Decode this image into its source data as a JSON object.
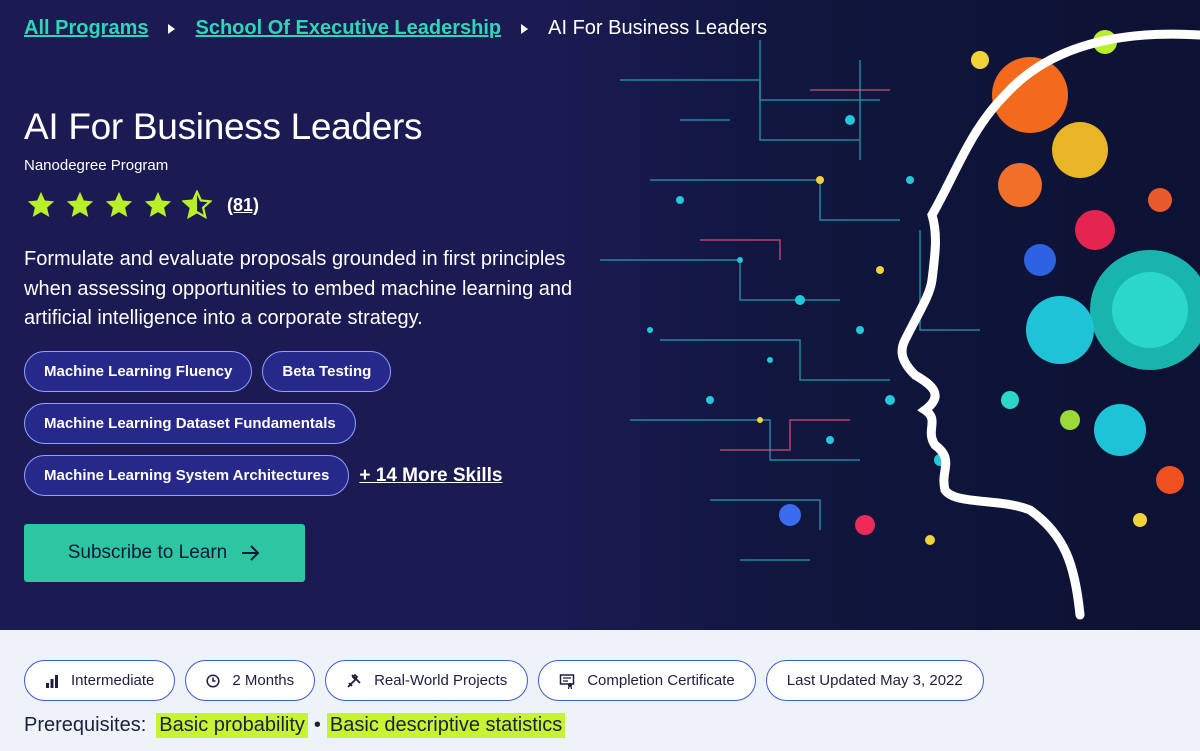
{
  "breadcrumb": {
    "items": [
      "All Programs",
      "School Of Executive Leadership"
    ],
    "current": "AI For Business Leaders"
  },
  "program": {
    "title": "AI For Business Leaders",
    "type": "Nanodegree Program",
    "rating": 4.5,
    "rating_count": "(81)",
    "description": "Formulate and evaluate proposals grounded in first principles when assessing opportunities to embed machine learning and artificial intelligence into a corporate strategy."
  },
  "skills": {
    "items": [
      "Machine Learning Fluency",
      "Beta Testing",
      "Machine Learning Dataset Fundamentals",
      "Machine Learning System Architectures"
    ],
    "more": "+ 14 More Skills"
  },
  "cta": {
    "label": "Subscribe to Learn"
  },
  "meta": {
    "level": "Intermediate",
    "duration": "2 Months",
    "projects": "Real-World Projects",
    "certificate": "Completion Certificate",
    "updated": "Last Updated May 3, 2022"
  },
  "prerequisites": {
    "label": "Prerequisites:",
    "items": [
      "Basic probability",
      "Basic descriptive statistics"
    ]
  },
  "colors": {
    "hero_bg": "#1b1a52",
    "accent_teal": "#2cc6a0",
    "star_green": "#b8ee2a",
    "highlight": "#c6f432",
    "pill_border": "#8fa0ff"
  },
  "icons": [
    "arrow-right-icon",
    "bar-chart-icon",
    "clock-icon",
    "tools-icon",
    "certificate-icon",
    "star-icon",
    "half-star-icon"
  ]
}
